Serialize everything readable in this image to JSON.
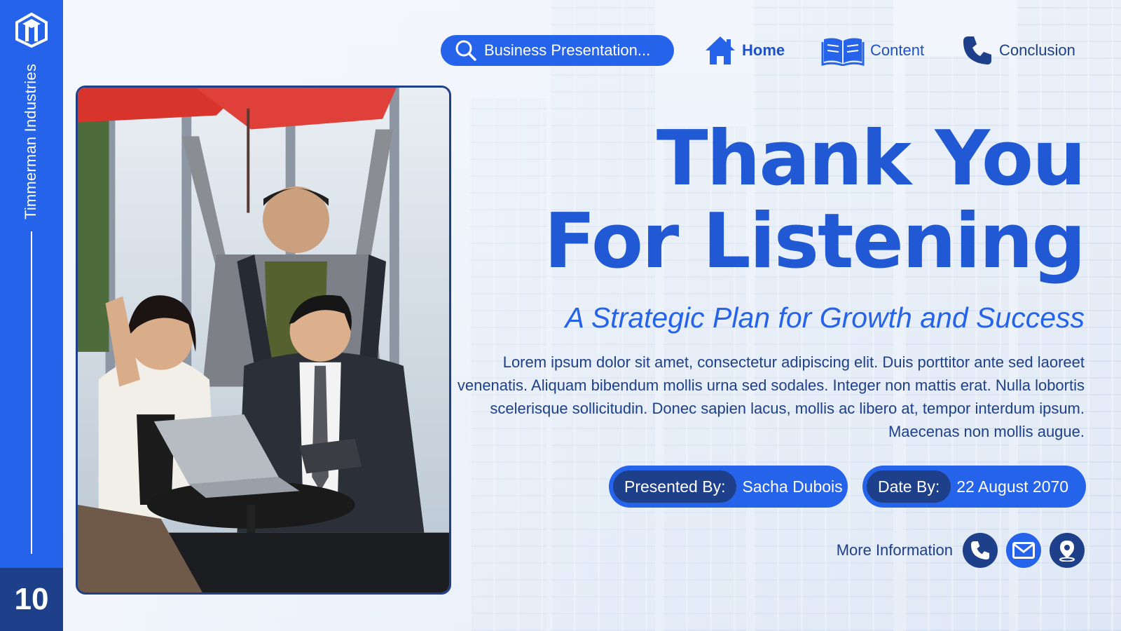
{
  "sidebar": {
    "company": "Timmerman Industries",
    "page_number": "10",
    "logo_icon": "cube-logo-icon"
  },
  "nav": {
    "search_label": "Business Presentation...",
    "home_label": "Home",
    "content_label": "Content",
    "conclusion_label": "Conclusion",
    "icons": [
      "search-icon",
      "home-icon",
      "book-icon",
      "phone-icon"
    ]
  },
  "main": {
    "title_line1": "Thank You",
    "title_line2": "For Listening",
    "subtitle": "A Strategic Plan for Growth and Success",
    "body": "Lorem ipsum dolor sit amet, consectetur adipiscing elit. Duis porttitor ante sed laoreet venenatis. Aliquam bibendum mollis urna sed sodales. Integer non mattis erat. Nulla lobortis scelerisque sollicitudin. Donec sapien lacus, mollis ac libero at, tempor interdum ipsum. Maecenas non mollis augue."
  },
  "info": {
    "presenter_label": "Presented By:",
    "presenter_value": "Sacha Dubois",
    "date_label": "Date By:",
    "date_value": "22 August 2070"
  },
  "more": {
    "label": "More Information",
    "icons": [
      "phone-icon",
      "mail-icon",
      "location-icon"
    ]
  },
  "colors": {
    "primary": "#2563eb",
    "dark": "#1e3f8a",
    "title": "#2158d4"
  }
}
